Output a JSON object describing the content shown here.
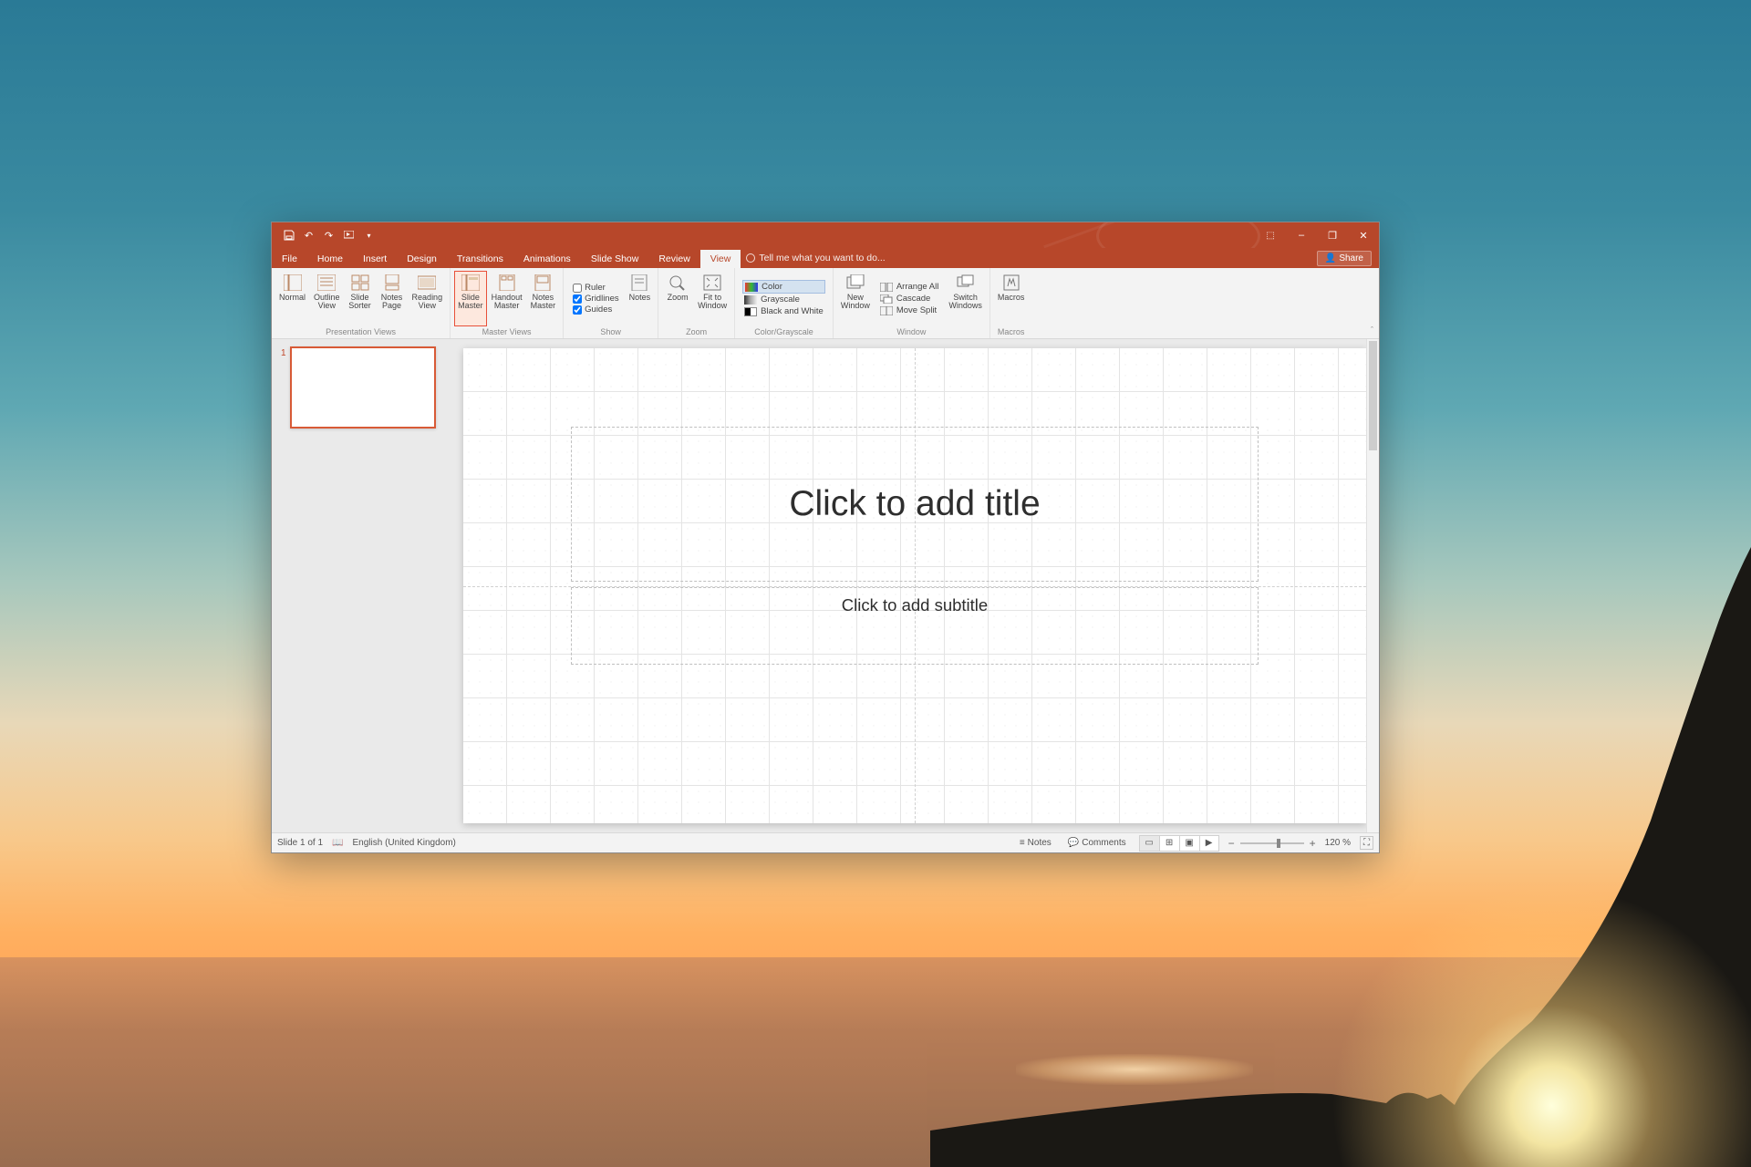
{
  "qat": {
    "save": "",
    "undo": "",
    "redo": "",
    "start": ""
  },
  "window_controls": {
    "minimize": "–",
    "restore": "❐",
    "close": "✕",
    "rubopts": "▾",
    "help": "?"
  },
  "tabs": [
    "File",
    "Home",
    "Insert",
    "Design",
    "Transitions",
    "Animations",
    "Slide Show",
    "Review",
    "View"
  ],
  "active_tab": "View",
  "tell_me": "Tell me what you want to do...",
  "share": "Share",
  "ribbon": {
    "presentation_views": {
      "label": "Presentation Views",
      "normal": "Normal",
      "outline": "Outline\nView",
      "sorter": "Slide\nSorter",
      "notes": "Notes\nPage",
      "reading": "Reading\nView"
    },
    "master_views": {
      "label": "Master Views",
      "slide": "Slide\nMaster",
      "handout": "Handout\nMaster",
      "notes": "Notes\nMaster"
    },
    "show": {
      "label": "Show",
      "ruler": "Ruler",
      "gridlines": "Gridlines",
      "guides": "Guides"
    },
    "notes_btn": "Notes",
    "zoom": {
      "label": "Zoom",
      "zoom": "Zoom",
      "fit": "Fit to\nWindow"
    },
    "color": {
      "label": "Color/Grayscale",
      "color": "Color",
      "grayscale": "Grayscale",
      "bw": "Black and White"
    },
    "window": {
      "label": "Window",
      "new": "New\nWindow",
      "arrange": "Arrange All",
      "cascade": "Cascade",
      "split": "Move Split",
      "switch": "Switch\nWindows"
    },
    "macros": {
      "label": "Macros",
      "macros": "Macros"
    }
  },
  "slide": {
    "num": "1",
    "title_ph": "Click to add title",
    "subtitle_ph": "Click to add subtitle"
  },
  "status": {
    "slide": "Slide 1 of 1",
    "lang": "English (United Kingdom)",
    "notes": "Notes",
    "comments": "Comments",
    "zoom": "120 %"
  }
}
